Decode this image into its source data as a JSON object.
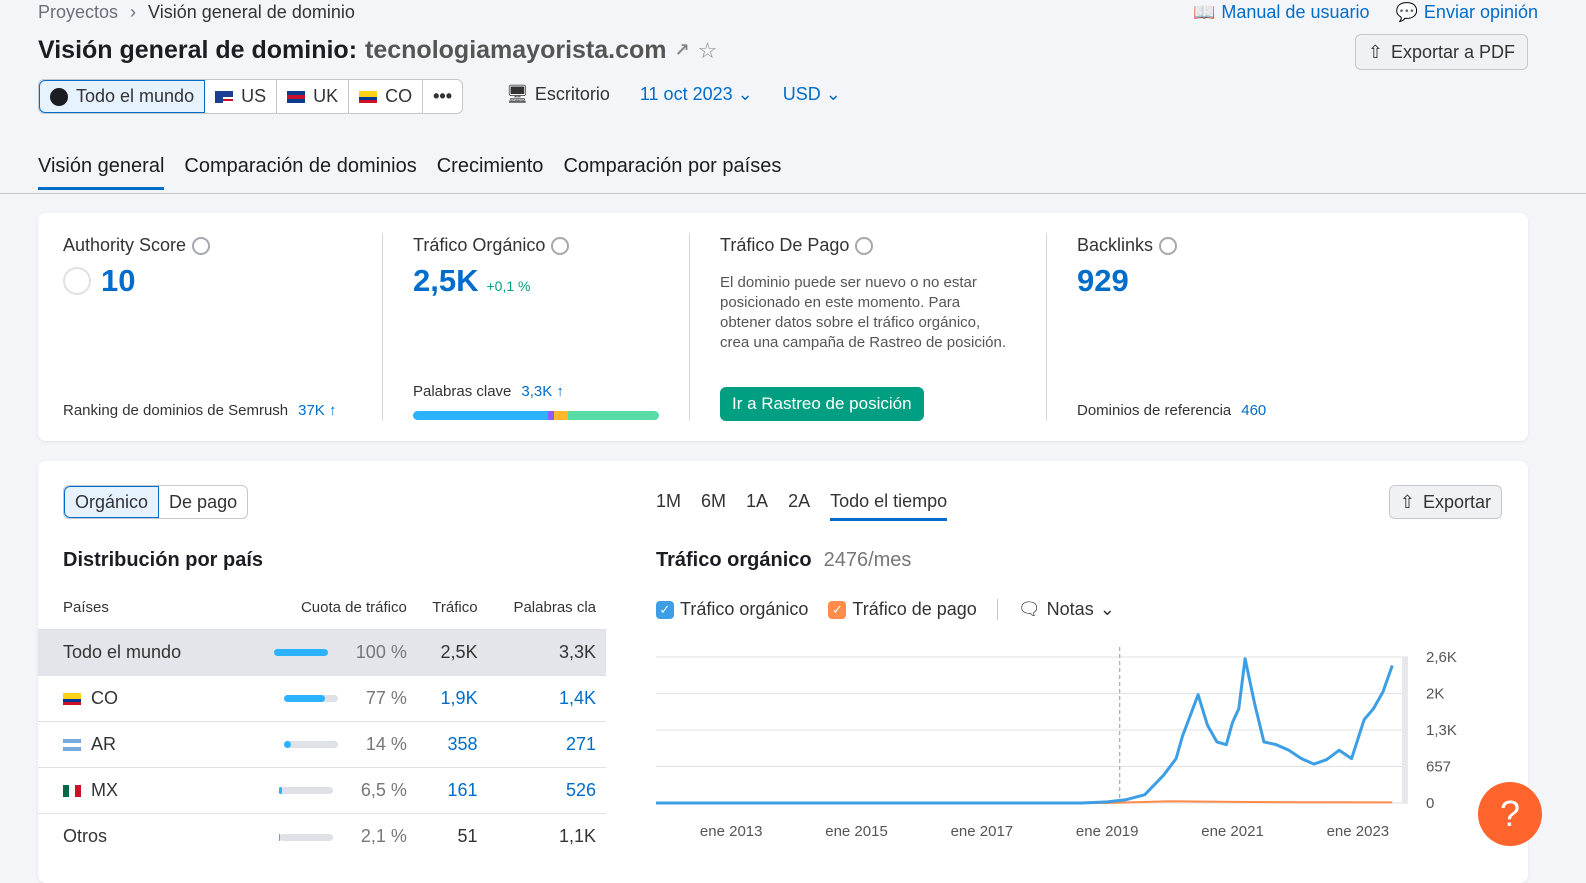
{
  "breadcrumb": {
    "root": "Proyectos",
    "current": "Visión general de dominio"
  },
  "top_links": {
    "manual": "Manual de usuario",
    "feedback": "Enviar opinión"
  },
  "title": {
    "prefix": "Visión general de dominio:",
    "domain": "tecnologiamayorista.com"
  },
  "export_pdf": "Exportar a PDF",
  "regions": [
    {
      "label": "Todo el mundo",
      "active": true
    },
    {
      "label": "US"
    },
    {
      "label": "UK"
    },
    {
      "label": "CO"
    },
    {
      "label": "•••"
    }
  ],
  "device": "Escritorio",
  "date": "11 oct 2023",
  "currency": "USD",
  "tabs": [
    "Visión general",
    "Comparación de dominios",
    "Crecimiento",
    "Comparación por países"
  ],
  "metrics": {
    "authority": {
      "label": "Authority Score",
      "value": "10",
      "foot_label": "Ranking de dominios de Semrush",
      "foot_value": "37K ↑"
    },
    "organic": {
      "label": "Tráfico Orgánico",
      "value": "2,5K",
      "delta": "+0,1 %",
      "foot_label": "Palabras clave",
      "foot_value": "3,3K ↑"
    },
    "paid": {
      "label": "Tráfico De Pago",
      "text": "El dominio puede ser nuevo o no estar posicionado en este momento. Para obtener datos sobre el tráfico orgánico, crea una campaña de Rastreo de posición.",
      "button": "Ir a Rastreo de posición"
    },
    "backlinks": {
      "label": "Backlinks",
      "value": "929",
      "foot_label": "Dominios de referencia",
      "foot_value": "460"
    }
  },
  "traffic_toggle": {
    "organic": "Orgánico",
    "paid": "De pago"
  },
  "distribution": {
    "title": "Distribución por país",
    "headers": [
      "Países",
      "Cuota de tráfico",
      "Tráfico",
      "Palabras cla"
    ],
    "rows": [
      {
        "country": "Todo el mundo",
        "share": "100 %",
        "share_pct": 100,
        "traffic": "2,5K",
        "keywords": "3,3K"
      },
      {
        "country": "CO",
        "share": "77 %",
        "share_pct": 77,
        "traffic": "1,9K",
        "keywords": "1,4K"
      },
      {
        "country": "AR",
        "share": "14 %",
        "share_pct": 14,
        "traffic": "358",
        "keywords": "271"
      },
      {
        "country": "MX",
        "share": "6,5 %",
        "share_pct": 6.5,
        "traffic": "161",
        "keywords": "526"
      },
      {
        "country": "Otros",
        "share": "2,1 %",
        "share_pct": 2.1,
        "traffic": "51",
        "keywords": "1,1K"
      }
    ]
  },
  "ranges": [
    "1M",
    "6M",
    "1A",
    "2A",
    "Todo el tiempo"
  ],
  "export": "Exportar",
  "chart_header": {
    "title": "Tráfico orgánico",
    "value": "2476/mes"
  },
  "legend": {
    "organic": "Tráfico orgánico",
    "paid": "Tráfico de pago",
    "notes": "Notas"
  },
  "colors": {
    "organic": "#3c9ee5",
    "paid": "#ff8c4a",
    "accent": "#006dca",
    "green": "#009f81"
  },
  "chart_data": {
    "type": "line",
    "x_ticks": [
      "ene 2013",
      "ene 2015",
      "ene 2017",
      "ene 2019",
      "ene 2021",
      "ene 2023"
    ],
    "y_ticks": [
      "2,6K",
      "2K",
      "1,3K",
      "657",
      "0"
    ],
    "ylim": [
      0,
      2630
    ],
    "xlim": [
      2011.8,
      2023.8
    ],
    "series": [
      {
        "name": "Tráfico orgánico",
        "points": [
          [
            2011.8,
            0
          ],
          [
            2018.6,
            0
          ],
          [
            2019.0,
            20
          ],
          [
            2019.3,
            60
          ],
          [
            2019.6,
            150
          ],
          [
            2019.9,
            500
          ],
          [
            2020.1,
            800
          ],
          [
            2020.2,
            1200
          ],
          [
            2020.3,
            1500
          ],
          [
            2020.45,
            1950
          ],
          [
            2020.6,
            1400
          ],
          [
            2020.75,
            1100
          ],
          [
            2020.9,
            1050
          ],
          [
            2021.0,
            1450
          ],
          [
            2021.1,
            1700
          ],
          [
            2021.2,
            2600
          ],
          [
            2021.35,
            1800
          ],
          [
            2021.5,
            1100
          ],
          [
            2021.7,
            1050
          ],
          [
            2021.9,
            950
          ],
          [
            2022.1,
            800
          ],
          [
            2022.3,
            700
          ],
          [
            2022.5,
            780
          ],
          [
            2022.7,
            950
          ],
          [
            2022.9,
            800
          ],
          [
            2023.1,
            1500
          ],
          [
            2023.25,
            1700
          ],
          [
            2023.4,
            2000
          ],
          [
            2023.55,
            2476
          ]
        ]
      },
      {
        "name": "Tráfico de pago",
        "points": [
          [
            2011.8,
            0
          ],
          [
            2019.0,
            0
          ],
          [
            2020.0,
            30
          ],
          [
            2021.0,
            20
          ],
          [
            2022.0,
            15
          ],
          [
            2023.55,
            10
          ]
        ]
      }
    ]
  }
}
